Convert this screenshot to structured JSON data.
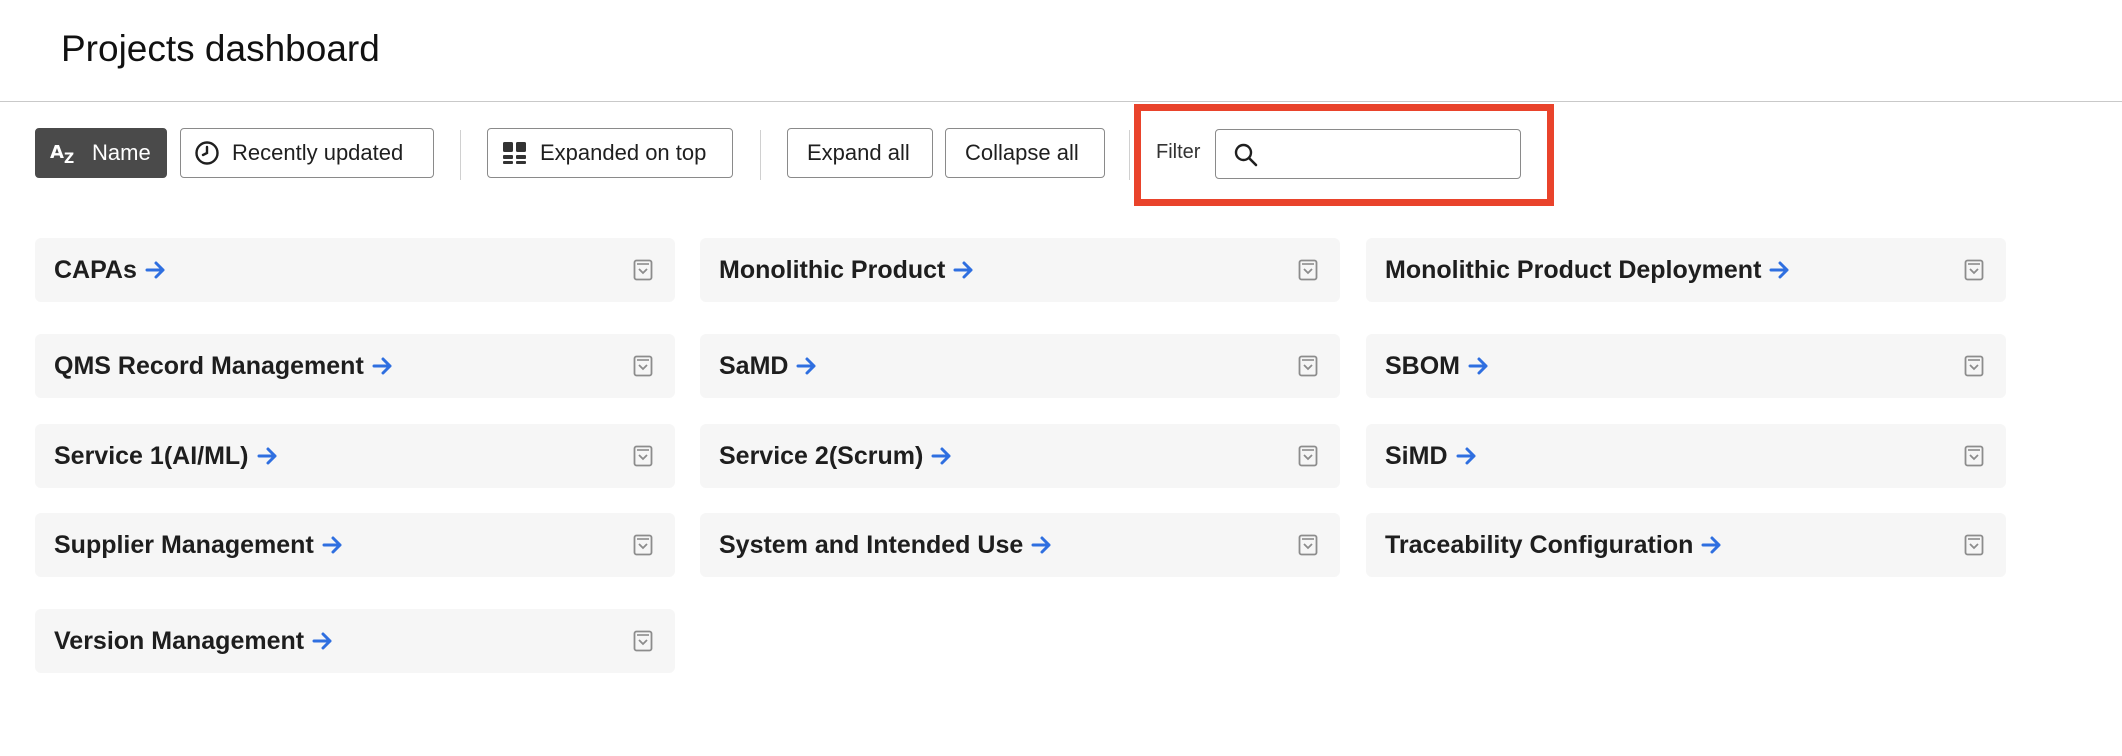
{
  "header": {
    "title": "Projects dashboard"
  },
  "toolbar": {
    "sort_name_label": "Name",
    "sort_recent_label": "Recently updated",
    "expanded_on_top_label": "Expanded on top",
    "expand_all_label": "Expand all",
    "collapse_all_label": "Collapse all"
  },
  "filter": {
    "label": "Filter",
    "value": "",
    "placeholder": ""
  },
  "colors": {
    "highlight": "#e9432b",
    "link_arrow": "#2f6fe0",
    "active_button": "#4a4a4a",
    "card_background": "#f6f6f6"
  },
  "projects": [
    {
      "name": "CAPAs"
    },
    {
      "name": "Monolithic Product"
    },
    {
      "name": "Monolithic Product Deployment"
    },
    {
      "name": "QMS Record Management"
    },
    {
      "name": "SaMD"
    },
    {
      "name": "SBOM"
    },
    {
      "name": "Service 1(AI/ML)"
    },
    {
      "name": "Service 2(Scrum)"
    },
    {
      "name": "SiMD"
    },
    {
      "name": "Supplier Management"
    },
    {
      "name": "System and Intended Use"
    },
    {
      "name": "Traceability Configuration"
    },
    {
      "name": "Version Management"
    }
  ]
}
